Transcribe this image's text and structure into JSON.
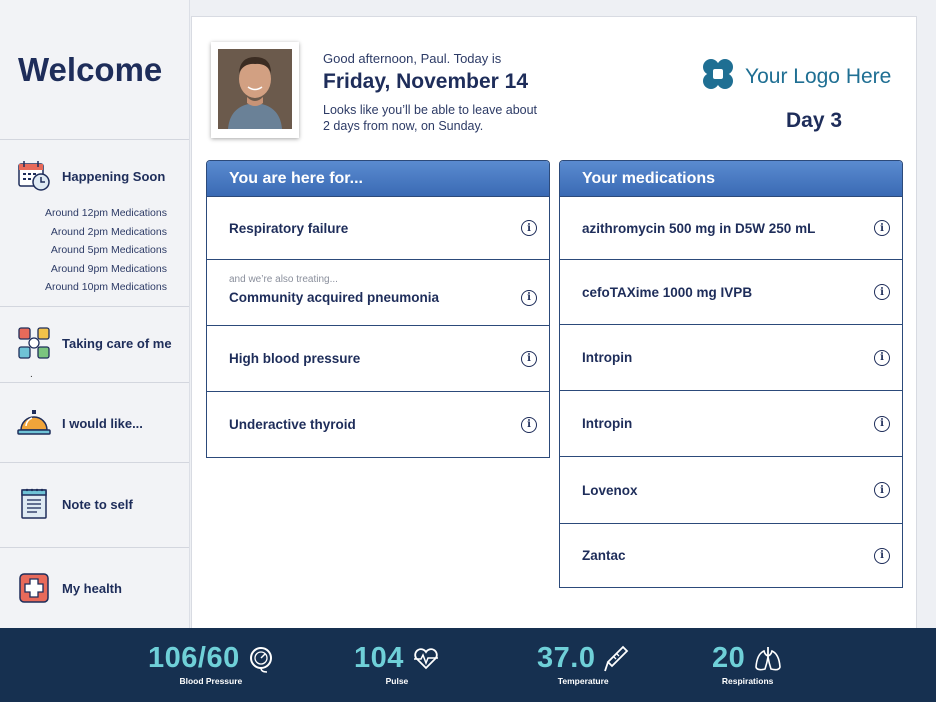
{
  "sidebar": {
    "welcome": "Welcome",
    "happening_soon": {
      "label": "Happening Soon",
      "icon": "calendar-clock-icon",
      "items": [
        "Around 12pm Medications",
        "Around 2pm Medications",
        "Around 5pm Medications",
        "Around 9pm Medications",
        "Around 10pm Medications"
      ]
    },
    "care": {
      "label": "Taking care of me",
      "icon": "care-team-icon",
      "dot": "."
    },
    "like": {
      "label": "I would like...",
      "icon": "service-bell-icon"
    },
    "note": {
      "label": "Note to self",
      "icon": "notepad-icon"
    },
    "health": {
      "label": "My health",
      "icon": "medical-cross-icon"
    }
  },
  "header": {
    "greeting": "Good afternoon, Paul. Today is",
    "date": "Friday, November 14",
    "discharge_line1": "Looks like you’ll be able to leave about",
    "discharge_line2": "2 days from now, on Sunday.",
    "logo_text": "Your Logo Here",
    "day": "Day 3"
  },
  "here_for": {
    "title": "You are here for...",
    "items": [
      {
        "label": "Respiratory failure",
        "sub": ""
      },
      {
        "label": "Community acquired pneumonia",
        "sub": "and we’re also treating..."
      },
      {
        "label": "High blood pressure",
        "sub": ""
      },
      {
        "label": "Underactive thyroid",
        "sub": ""
      }
    ]
  },
  "medications": {
    "title": "Your medications",
    "items": [
      "azithromycin 500 mg in D5W 250 mL",
      "cefoTAXime 1000 mg IVPB",
      "Intropin",
      "Intropin",
      "Lovenox",
      "Zantac"
    ]
  },
  "info_glyph": "i",
  "vitals": [
    {
      "value": "106/60",
      "label": "Blood Pressure",
      "icon": "gauge-icon"
    },
    {
      "value": "104",
      "label": "Pulse",
      "icon": "heartbeat-icon"
    },
    {
      "value": "37.0",
      "label": "Temperature",
      "icon": "thermometer-icon"
    },
    {
      "value": "20",
      "label": "Respirations",
      "icon": "lungs-icon"
    }
  ],
  "colors": {
    "navy": "#1e2d5a",
    "panel_header": "#3a6ab4",
    "vitals_bg": "#163050",
    "vitals_value": "#6fd0d8",
    "logo": "#1f6f93"
  }
}
